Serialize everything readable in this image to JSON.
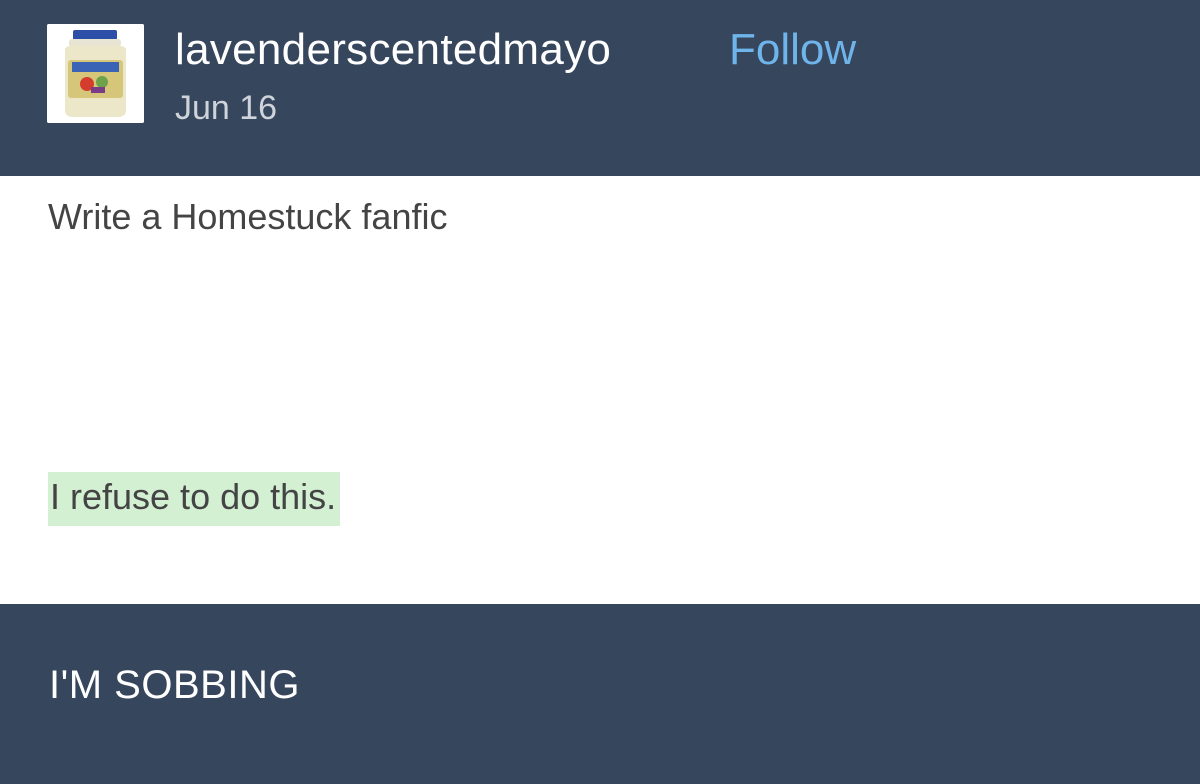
{
  "post": {
    "username": "lavenderscentedmayo",
    "follow_label": "Follow",
    "date": "Jun 16",
    "avatar_icon": "mayonnaise-jar-icon",
    "body_lines": [
      "Write a Homestuck fanfic",
      "I refuse to do this."
    ]
  },
  "reply": {
    "text": "I'M SOBBING"
  },
  "colors": {
    "header_bg": "#36465d",
    "body_bg": "#ffffff",
    "follow_link": "#6fb4ea",
    "highlight": "#d3f0d3"
  }
}
